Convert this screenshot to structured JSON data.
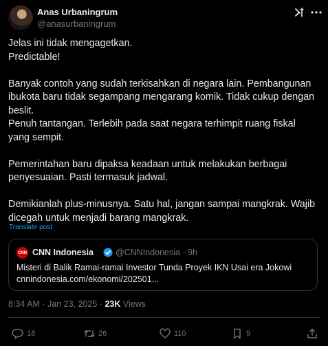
{
  "author": {
    "name": "Anas Urbaningrum",
    "handle": "@anasurbaningrum"
  },
  "post": {
    "lines": [
      "Jelas ini tidak mengagetkan.",
      "Predictable!",
      "",
      "Banyak contoh yang sudah terkisahkan di negara lain. Pembangunan ibukota baru tidak segampang mengarang komik. Tidak cukup dengan beslit.",
      "Penuh tantangan. Terlebih pada saat negara terhimpit  ruang fiskal yang sempit.",
      "",
      "Pemerintahan baru dipaksa keadaan untuk melakukan berbagai penyesuaian. Pasti termasuk jadwal.",
      "",
      "Demikianlah plus-minusnya. Satu hal, jangan sampai mangkrak. Wajib dicegah untuk menjadi barang mangkrak."
    ],
    "translate_label": "Translate post"
  },
  "quote": {
    "logo_text": "CNN",
    "name": "CNN Indonesia",
    "handle": "@CNNIndonesia",
    "separator": "·",
    "time": "9h",
    "text": "Misteri di Balik Ramai-ramai Investor Tunda Proyek IKN Usai era Jokowi",
    "link": "cnnindonesia.com/ekonomi/202501..."
  },
  "meta": {
    "time": "8:34 AM",
    "separator": "·",
    "date": "Jan 23, 2025",
    "separator2": "·",
    "views_count": "23K",
    "views_label": "Views"
  },
  "actions": {
    "replies": "18",
    "reposts": "26",
    "likes": "110",
    "bookmarks": "9"
  },
  "icons": {
    "grok": "grok-icon",
    "more": "more-icon",
    "verified": "verified-badge-icon",
    "reply": "reply-icon",
    "repost": "repost-icon",
    "like": "heart-icon",
    "bookmark": "bookmark-icon",
    "share": "share-icon"
  },
  "colors": {
    "background": "#000000",
    "text": "#e7e9ea",
    "muted": "#71767b",
    "link": "#1d9bf0",
    "border": "#2f3336",
    "cnn_red": "#cc0000"
  }
}
